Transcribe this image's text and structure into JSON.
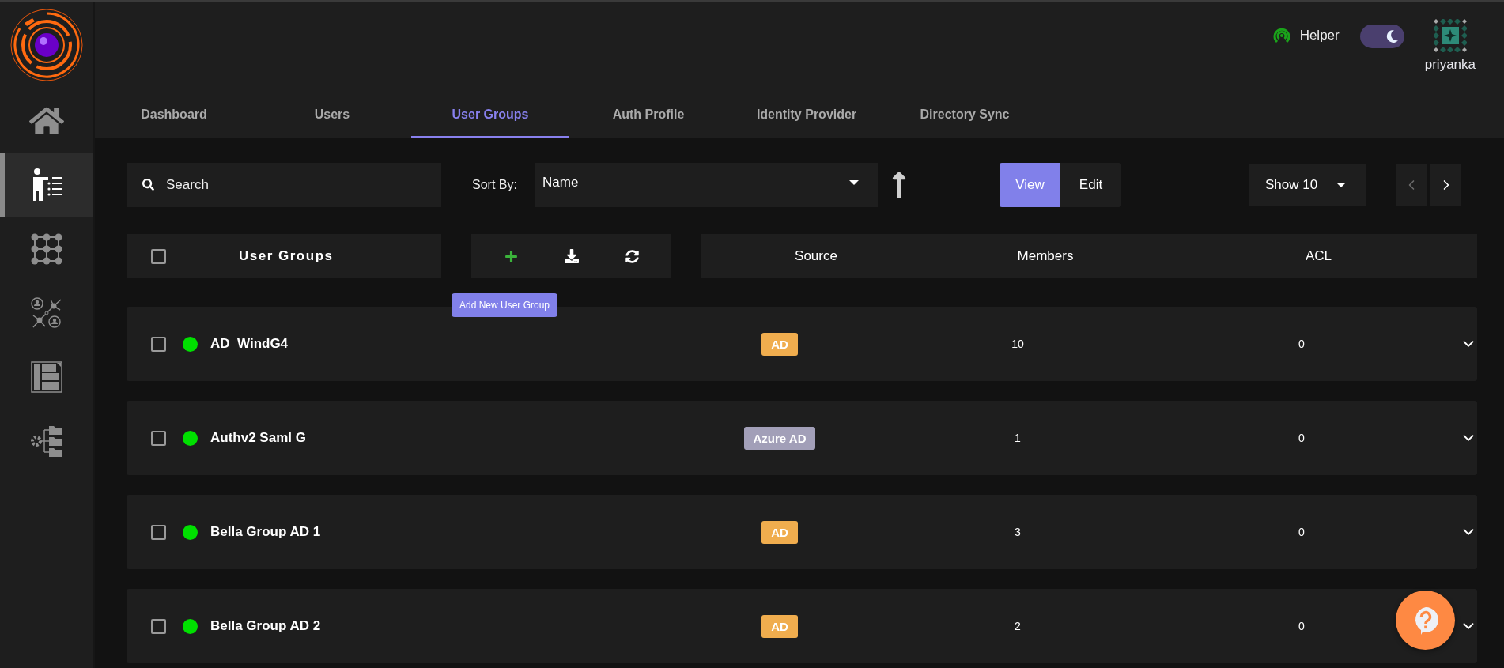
{
  "sidebar": {
    "items": [
      {
        "kind": "home",
        "selected": false
      },
      {
        "kind": "users",
        "selected": true
      },
      {
        "kind": "grid",
        "selected": false
      },
      {
        "kind": "network",
        "selected": false
      },
      {
        "kind": "document",
        "selected": false
      },
      {
        "kind": "folders",
        "selected": false
      }
    ]
  },
  "header": {
    "helper": "Helper",
    "theme_toggle": {
      "on": true
    },
    "user": {
      "name": "priyanka"
    }
  },
  "tabs": [
    {
      "label": "Dashboard",
      "selected": false
    },
    {
      "label": "Users",
      "selected": false
    },
    {
      "label": "User Groups",
      "selected": true
    },
    {
      "label": "Auth Profile",
      "selected": false
    },
    {
      "label": "Identity Provider",
      "selected": false
    },
    {
      "label": "Directory Sync",
      "selected": false
    }
  ],
  "toolbar": {
    "search": {
      "placeholder": "Search"
    },
    "sort": {
      "label": "Sort By:",
      "value": "Name"
    },
    "view_modes": [
      {
        "label": "View",
        "selected": true
      },
      {
        "label": "Edit",
        "selected": false
      }
    ],
    "page_size": "Show 10",
    "pager": {
      "prev_disabled": true,
      "next_disabled": false
    }
  },
  "table": {
    "select_all": {
      "checked": false
    },
    "title": "User Groups",
    "actions_tooltip": "Add New User Group",
    "columns": [
      "Source",
      "Members",
      "ACL"
    ],
    "rows": [
      {
        "checked": false,
        "color": "#00e000",
        "name": "AD_WindG4",
        "source": {
          "label": "AD",
          "color": "#f0ad4e"
        },
        "members": "10",
        "acl": "0",
        "expanded": false
      },
      {
        "checked": false,
        "color": "#00e000",
        "name": "Authv2 Saml G",
        "source": {
          "label": "Azure AD",
          "color": "#a29fb8"
        },
        "members": "1",
        "acl": "0",
        "expanded": false
      },
      {
        "checked": false,
        "color": "#00e000",
        "name": "Bella Group AD 1",
        "source": {
          "label": "AD",
          "color": "#f0ad4e"
        },
        "members": "3",
        "acl": "0",
        "expanded": false
      },
      {
        "checked": false,
        "color": "#00e000",
        "name": "Bella Group AD 2",
        "source": {
          "label": "AD",
          "color": "#f0ad4e"
        },
        "members": "2",
        "acl": "0",
        "expanded": false
      }
    ]
  }
}
